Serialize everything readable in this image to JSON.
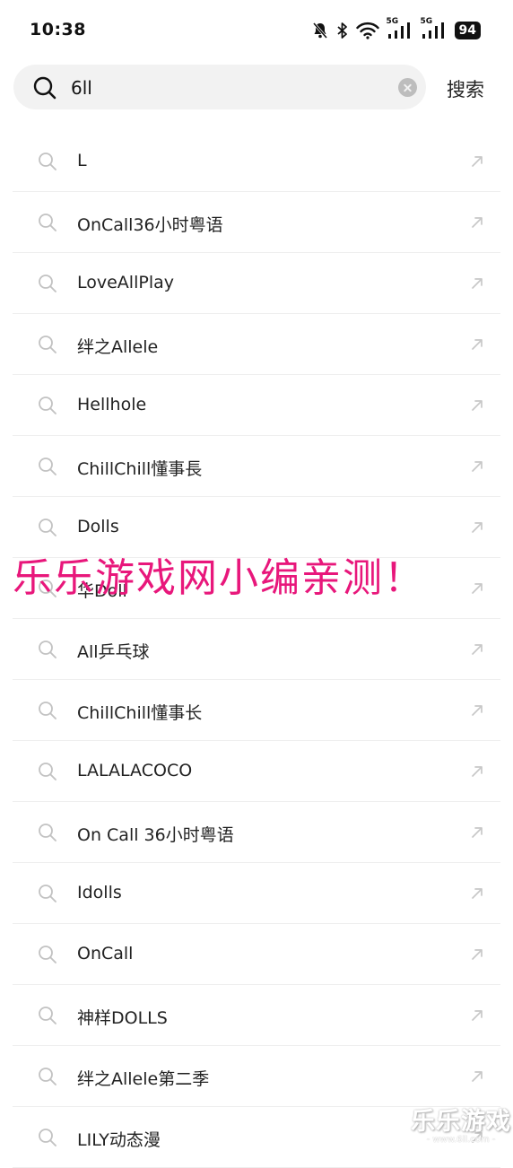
{
  "status_bar": {
    "time": "10:38",
    "network_1": "5G",
    "network_2": "5G",
    "battery": "94"
  },
  "search": {
    "query": "6ll",
    "button_label": "搜索"
  },
  "suggestions": [
    "L",
    "OnCall36小时粤语",
    "LoveAllPlay",
    "绊之Allele",
    "Hellhole",
    "ChillChill懂事長",
    "Dolls",
    "华Doll",
    "All乒乓球",
    "ChillChill懂事长",
    "LALALACOCO",
    "On Call 36小时粤语",
    "Idolls",
    "OnCall",
    "神样DOLLS",
    "绊之Allele第二季",
    "LILY动态漫"
  ],
  "overlay": {
    "watermark_text": "乐乐游戏网小编亲测！",
    "logo_text": "乐乐游戏",
    "logo_url": "- www.6ll.com -"
  },
  "colors": {
    "watermark": "#e8177b",
    "search_bg": "#f2f2f2"
  },
  "icons": {
    "search": "magnifier-icon",
    "fill_suggestion": "arrow-up-left-icon",
    "clear": "clear-circle-icon"
  }
}
